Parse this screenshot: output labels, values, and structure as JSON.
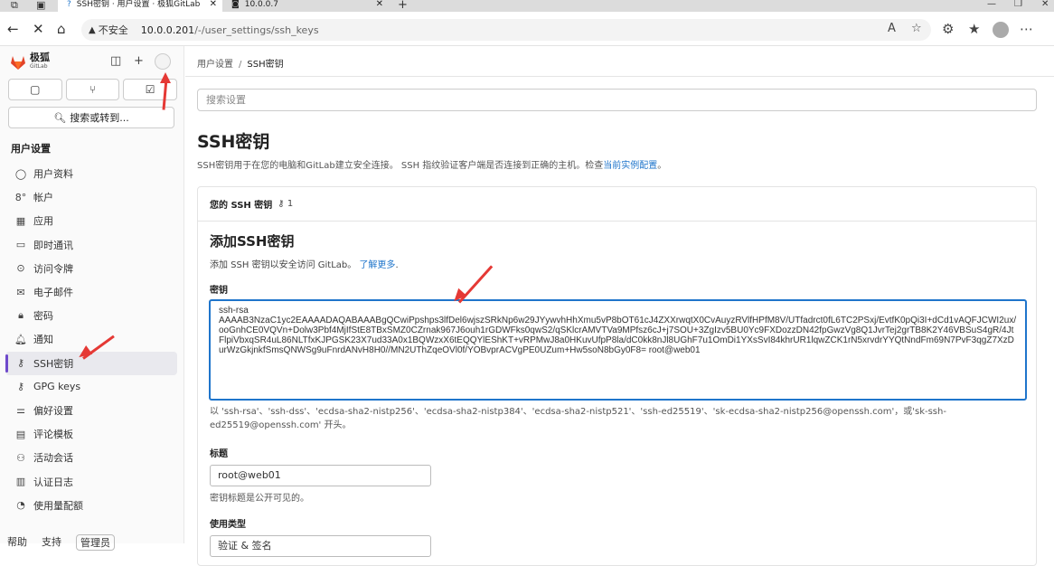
{
  "browser": {
    "active_tab": "SSH密钥 · 用户设置 · 极狐GitLab",
    "other_tab": "10.0.0.7",
    "not_secure": "不安全",
    "url_host": "10.0.0.201",
    "url_path": "/-/user_settings/ssh_keys"
  },
  "sidebar": {
    "brand": "极狐",
    "brand_sub": "GitLab",
    "search_label": "搜索或转到...",
    "section_title": "用户设置",
    "items": [
      {
        "label": "用户资料",
        "icon": "profile-icon"
      },
      {
        "label": "帐户",
        "icon": "account-icon"
      },
      {
        "label": "应用",
        "icon": "applications-icon"
      },
      {
        "label": "即时通讯",
        "icon": "chat-icon"
      },
      {
        "label": "访问令牌",
        "icon": "token-icon"
      },
      {
        "label": "电子邮件",
        "icon": "mail-icon"
      },
      {
        "label": "密码",
        "icon": "lock-icon"
      },
      {
        "label": "通知",
        "icon": "bell-icon"
      },
      {
        "label": "SSH密钥",
        "icon": "key-icon",
        "active": true
      },
      {
        "label": "GPG keys",
        "icon": "gpg-key-icon"
      },
      {
        "label": "偏好设置",
        "icon": "preferences-icon"
      },
      {
        "label": "评论模板",
        "icon": "comment-template-icon"
      },
      {
        "label": "活动会话",
        "icon": "session-icon"
      },
      {
        "label": "认证日志",
        "icon": "log-icon"
      },
      {
        "label": "使用量配额",
        "icon": "quota-icon"
      }
    ],
    "bottom": [
      "帮助",
      "支持",
      "管理员"
    ]
  },
  "main": {
    "breadcrumb_parent": "用户设置",
    "breadcrumb_current": "SSH密钥",
    "search_placeholder": "搜索设置",
    "title": "SSH密钥",
    "description": "SSH密钥用于在您的电脑和GitLab建立安全连接。 SSH 指纹验证客户端是否连接到正确的主机。检查",
    "description_link": "当前实例配置",
    "description_end": "。",
    "card_header": "您的 SSH 密钥",
    "key_count": "1",
    "add_title": "添加SSH密钥",
    "add_sub": "添加 SSH 密钥以安全访问 GitLab。",
    "learn_more": "了解更多",
    "key_label": "密钥",
    "key_value": "ssh-rsa\nAAAAB3NzaC1yc2EAAAADAQABAAABgQCwiPpshps3lfDel6wjszSRkNp6w29JYywvhHhXmu5vP8bOT61cJ4ZXXrwqtX0CvAuyzRVlfHPfM8V/UTfadrct0fL6TC2PSxj/EvtfK0pQi3I+dCd1vAQFJCWI2ux/ooGnhCE0VQVn+Dolw3Pbf4MjIfStE8TBxSMZ0CZrnak967J6ouh1rGDWFks0qwS2/qSKlcrAMVTVa9MPfsz6cJ+j7SOU+3ZgIzv5BU0Yc9FXDozzDN42fpGwzVg8Q1JvrTej2grTB8K2Y46VBSuS4gR/4JtFlpiVbxqSR4uL86NLTfxKJPGSK23X7ud33A0x1BQWzxX6tEQQYlEShKT+vRPMwJ8a0HKuvUfpP8la/dC0kk8nJl8UGhF7u1OmDi1YXsSvI84khrUR1lqwZCK1rN5xrvdrYYQtNndFm69N7PvF3qgZ7XzDurWzGkjnkfSmsQNWSg9uFnrdANvH8H0//MN2UThZqeOVl0f/YOBvprACVgPE0UZum+Hw5soN8bGy0F8= root@web01",
    "key_hint": "以 'ssh-rsa'、'ssh-dss'、'ecdsa-sha2-nistp256'、'ecdsa-sha2-nistp384'、'ecdsa-sha2-nistp521'、'ssh-ed25519'、'sk-ecdsa-sha2-nistp256@openssh.com'，或'sk-ssh-ed25519@openssh.com' 开头。",
    "title_label": "标题",
    "title_value": "root@web01",
    "title_hint": "密钥标题是公开可见的。",
    "usage_label": "使用类型",
    "usage_value": "验证 & 签名"
  },
  "colors": {
    "accent": "#1f75cb",
    "active_indicator": "#6e49cb",
    "annotation_arrow": "#e53935"
  }
}
